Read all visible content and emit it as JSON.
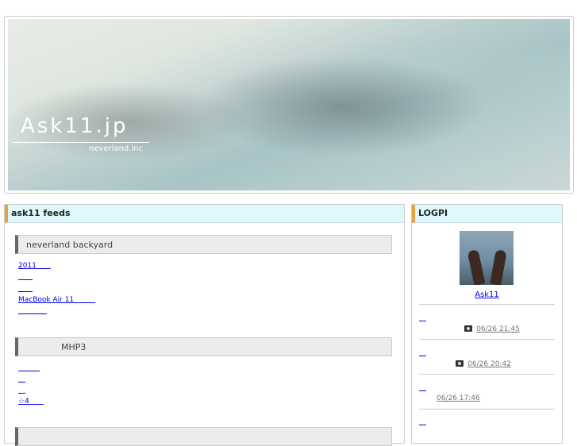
{
  "site": {
    "title": "Ask11.jp",
    "subtitle": "neverland.inc"
  },
  "main": {
    "header": "ask11 feeds",
    "sections": [
      {
        "title": "neverland backyard",
        "links": [
          "2011　　",
          "　　",
          "　　",
          "MacBook Air 11　　　",
          "　　　　"
        ]
      },
      {
        "title": "　　　　MHP3",
        "links": [
          "　　　",
          "　",
          "　",
          "☆4　　"
        ]
      }
    ]
  },
  "side": {
    "header": "LOGPI",
    "user": "Ask11",
    "posts": [
      {
        "link": "　",
        "time": "06/26 21:45",
        "icon": "camera-icon"
      },
      {
        "link": "　",
        "time": "06/26 20:42",
        "icon": "camera-icon"
      },
      {
        "link": "　",
        "time": "06/26 17:46",
        "icon": ""
      },
      {
        "link": "　",
        "time": "",
        "icon": ""
      }
    ]
  }
}
